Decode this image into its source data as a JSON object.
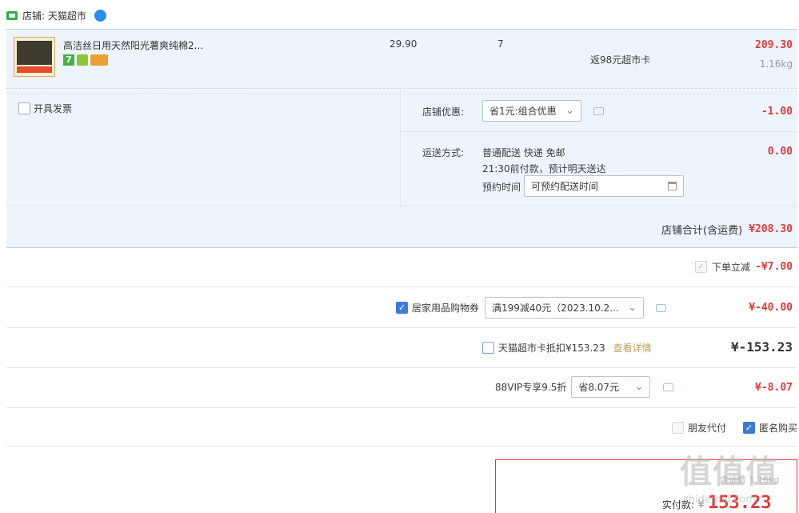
{
  "shop": {
    "label": "店铺: 天猫超市"
  },
  "item": {
    "title": "高洁丝日用天然阳光薯爽纯棉2...",
    "unit_price": "29.90",
    "quantity": "7",
    "rebate": "返98元超市卡",
    "subtotal": "209.30",
    "weight": "1.16kg",
    "badge_seven": "7"
  },
  "invoice": {
    "label": "开具发票"
  },
  "shop_discount": {
    "label": "店铺优惠:",
    "option": "省1元:组合优惠",
    "amount": "-1.00"
  },
  "shipping": {
    "label": "运送方式:",
    "method": "普通配送 快递 免邮",
    "eta": "21:30前付款，预计明天送达",
    "appointment_label": "预约时间",
    "appointment_placeholder": "可预约配送时间",
    "amount": "0.00"
  },
  "shop_total": {
    "label": "店铺合计(含运费)",
    "amount": "¥208.30"
  },
  "instant_discount": {
    "label": "下单立减",
    "amount": "-¥7.00"
  },
  "coupon": {
    "label": "居家用品购物券",
    "option": "满199减40元（2023.10.2...",
    "amount": "¥-40.00"
  },
  "card": {
    "label": "天猫超市卡抵扣¥153.23",
    "link": "查看详情",
    "amount": "¥-153.23"
  },
  "vip": {
    "label": "88VIP专享9.5折",
    "option": "省8.07元",
    "amount": "¥-8.07"
  },
  "options": {
    "friend_pay": "朋友代付",
    "anonymous": "匿名购买"
  },
  "footer": {
    "pay_label": "实付款:",
    "pay_currency": "¥",
    "pay_amount": "153.23",
    "faded_text": "含运费 1.16kg"
  },
  "watermark": {
    "text": "值值值",
    "subtext": "zhidemai.com"
  },
  "colors": {
    "accent_red": "#e4393c",
    "panel_blue": "#eef4fc",
    "check_blue": "#3b7bd6"
  }
}
